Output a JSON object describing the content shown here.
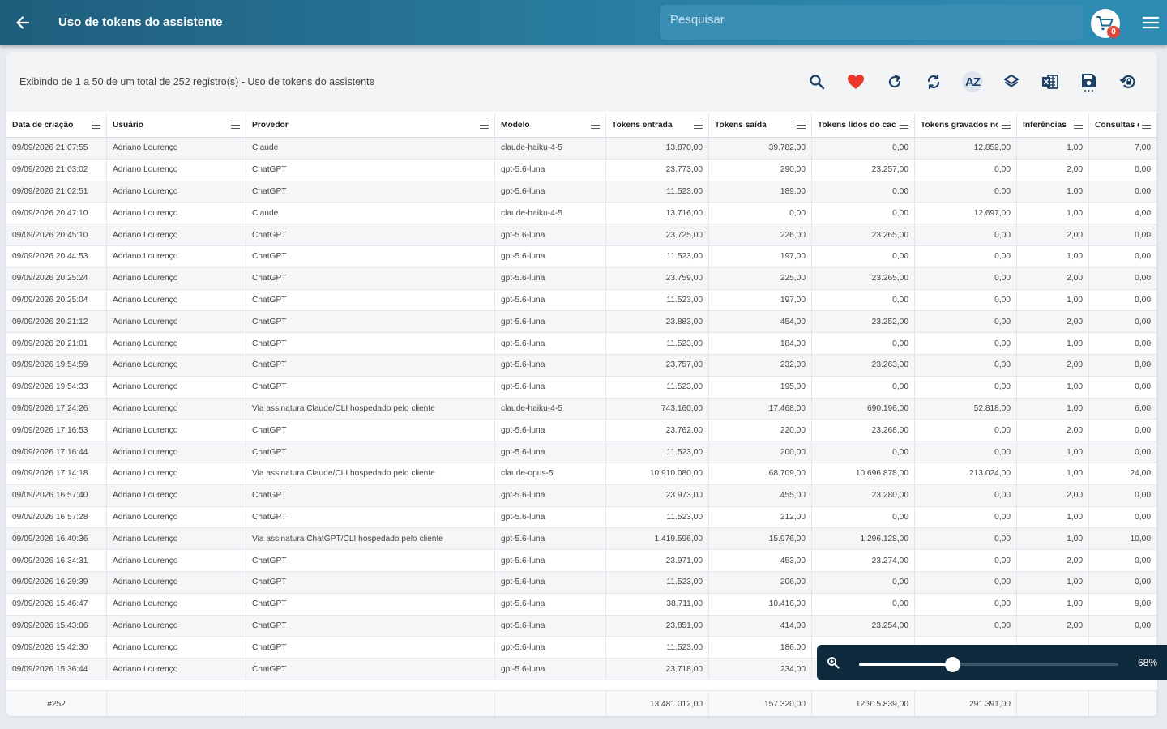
{
  "header": {
    "title": "Uso de tokens do assistente",
    "search_placeholder": "Pesquisar",
    "cart_count": "0",
    "colors": {
      "bar_start": "#1f5d7c",
      "bar_end": "#2f8db5",
      "badge": "#e04b3a"
    }
  },
  "toolbar": {
    "record_info": "Exibindo de 1 a 50 de um total de 252 registro(s) - Uso de tokens do assistente",
    "sort_label": "AZ",
    "icons": [
      "search-icon",
      "favorite-heart-icon",
      "refresh-icon",
      "sync-icon",
      "sort-az-icon",
      "layers-icon",
      "excel-export-icon",
      "save-icon",
      "restore-icon"
    ]
  },
  "table": {
    "columns": [
      "Data de criação",
      "Usuário",
      "Provedor",
      "Modelo",
      "Tokens entrada",
      "Tokens saída",
      "Tokens lidos do cache",
      "Tokens gravados no c...",
      "Inferências",
      "Consultas de ..."
    ],
    "rows": [
      [
        "09/09/2026 21:07:55",
        "Adriano Lourenço",
        "Claude",
        "claude-haiku-4-5",
        "13.870,00",
        "39.782,00",
        "0,00",
        "12.852,00",
        "1,00",
        "7,00"
      ],
      [
        "09/09/2026 21:03:02",
        "Adriano Lourenço",
        "ChatGPT",
        "gpt-5.6-luna",
        "23.773,00",
        "290,00",
        "23.257,00",
        "0,00",
        "2,00",
        "0,00"
      ],
      [
        "09/09/2026 21:02:51",
        "Adriano Lourenço",
        "ChatGPT",
        "gpt-5.6-luna",
        "11.523,00",
        "189,00",
        "0,00",
        "0,00",
        "1,00",
        "0,00"
      ],
      [
        "09/09/2026 20:47:10",
        "Adriano Lourenço",
        "Claude",
        "claude-haiku-4-5",
        "13.716,00",
        "0,00",
        "0,00",
        "12.697,00",
        "1,00",
        "4,00"
      ],
      [
        "09/09/2026 20:45:10",
        "Adriano Lourenço",
        "ChatGPT",
        "gpt-5.6-luna",
        "23.725,00",
        "226,00",
        "23.265,00",
        "0,00",
        "2,00",
        "0,00"
      ],
      [
        "09/09/2026 20:44:53",
        "Adriano Lourenço",
        "ChatGPT",
        "gpt-5.6-luna",
        "11.523,00",
        "197,00",
        "0,00",
        "0,00",
        "1,00",
        "0,00"
      ],
      [
        "09/09/2026 20:25:24",
        "Adriano Lourenço",
        "ChatGPT",
        "gpt-5.6-luna",
        "23.759,00",
        "225,00",
        "23.265,00",
        "0,00",
        "2,00",
        "0,00"
      ],
      [
        "09/09/2026 20:25:04",
        "Adriano Lourenço",
        "ChatGPT",
        "gpt-5.6-luna",
        "11.523,00",
        "197,00",
        "0,00",
        "0,00",
        "1,00",
        "0,00"
      ],
      [
        "09/09/2026 20:21:12",
        "Adriano Lourenço",
        "ChatGPT",
        "gpt-5.6-luna",
        "23.883,00",
        "454,00",
        "23.252,00",
        "0,00",
        "2,00",
        "0,00"
      ],
      [
        "09/09/2026 20:21:01",
        "Adriano Lourenço",
        "ChatGPT",
        "gpt-5.6-luna",
        "11.523,00",
        "184,00",
        "0,00",
        "0,00",
        "1,00",
        "0,00"
      ],
      [
        "09/09/2026 19:54:59",
        "Adriano Lourenço",
        "ChatGPT",
        "gpt-5.6-luna",
        "23.757,00",
        "232,00",
        "23.263,00",
        "0,00",
        "2,00",
        "0,00"
      ],
      [
        "09/09/2026 19:54:33",
        "Adriano Lourenço",
        "ChatGPT",
        "gpt-5.6-luna",
        "11.523,00",
        "195,00",
        "0,00",
        "0,00",
        "1,00",
        "0,00"
      ],
      [
        "09/09/2026 17:24:26",
        "Adriano Lourenço",
        "Via assinatura Claude/CLI hospedado pelo cliente",
        "claude-haiku-4-5",
        "743.160,00",
        "17.468,00",
        "690.196,00",
        "52.818,00",
        "1,00",
        "6,00"
      ],
      [
        "09/09/2026 17:16:53",
        "Adriano Lourenço",
        "ChatGPT",
        "gpt-5.6-luna",
        "23.762,00",
        "220,00",
        "23.268,00",
        "0,00",
        "2,00",
        "0,00"
      ],
      [
        "09/09/2026 17:16:44",
        "Adriano Lourenço",
        "ChatGPT",
        "gpt-5.6-luna",
        "11.523,00",
        "200,00",
        "0,00",
        "0,00",
        "1,00",
        "0,00"
      ],
      [
        "09/09/2026 17:14:18",
        "Adriano Lourenço",
        "Via assinatura Claude/CLI hospedado pelo cliente",
        "claude-opus-5",
        "10.910.080,00",
        "68.709,00",
        "10.696.878,00",
        "213.024,00",
        "1,00",
        "24,00"
      ],
      [
        "09/09/2026 16:57:40",
        "Adriano Lourenço",
        "ChatGPT",
        "gpt-5.6-luna",
        "23.973,00",
        "455,00",
        "23.280,00",
        "0,00",
        "2,00",
        "0,00"
      ],
      [
        "09/09/2026 16:57:28",
        "Adriano Lourenço",
        "ChatGPT",
        "gpt-5.6-luna",
        "11.523,00",
        "212,00",
        "0,00",
        "0,00",
        "1,00",
        "0,00"
      ],
      [
        "09/09/2026 16:40:36",
        "Adriano Lourenço",
        "Via assinatura ChatGPT/CLI hospedado pelo cliente",
        "gpt-5.6-luna",
        "1.419.596,00",
        "15.976,00",
        "1.296.128,00",
        "0,00",
        "1,00",
        "10,00"
      ],
      [
        "09/09/2026 16:34:31",
        "Adriano Lourenço",
        "ChatGPT",
        "gpt-5.6-luna",
        "23.971,00",
        "453,00",
        "23.274,00",
        "0,00",
        "2,00",
        "0,00"
      ],
      [
        "09/09/2026 16:29:39",
        "Adriano Lourenço",
        "ChatGPT",
        "gpt-5.6-luna",
        "11.523,00",
        "206,00",
        "0,00",
        "0,00",
        "1,00",
        "0,00"
      ],
      [
        "09/09/2026 15:46:47",
        "Adriano Lourenço",
        "ChatGPT",
        "gpt-5.6-luna",
        "38.711,00",
        "10.416,00",
        "0,00",
        "0,00",
        "1,00",
        "9,00"
      ],
      [
        "09/09/2026 15:43:06",
        "Adriano Lourenço",
        "ChatGPT",
        "gpt-5.6-luna",
        "23.851,00",
        "414,00",
        "23.254,00",
        "0,00",
        "2,00",
        "0,00"
      ],
      [
        "09/09/2026 15:42:30",
        "Adriano Lourenço",
        "ChatGPT",
        "gpt-5.6-luna",
        "11.523,00",
        "186,00",
        "",
        "",
        "",
        ""
      ],
      [
        "09/09/2026 15:36:44",
        "Adriano Lourenço",
        "ChatGPT",
        "gpt-5.6-luna",
        "23.718,00",
        "234,00",
        "",
        "",
        "",
        ""
      ]
    ],
    "footer": [
      "#252",
      "",
      "",
      "",
      "13.481.012,00",
      "157.320,00",
      "12.915.839,00",
      "291.391,00",
      "",
      ""
    ]
  },
  "zoom": {
    "label": "68%",
    "value": 0.68
  }
}
